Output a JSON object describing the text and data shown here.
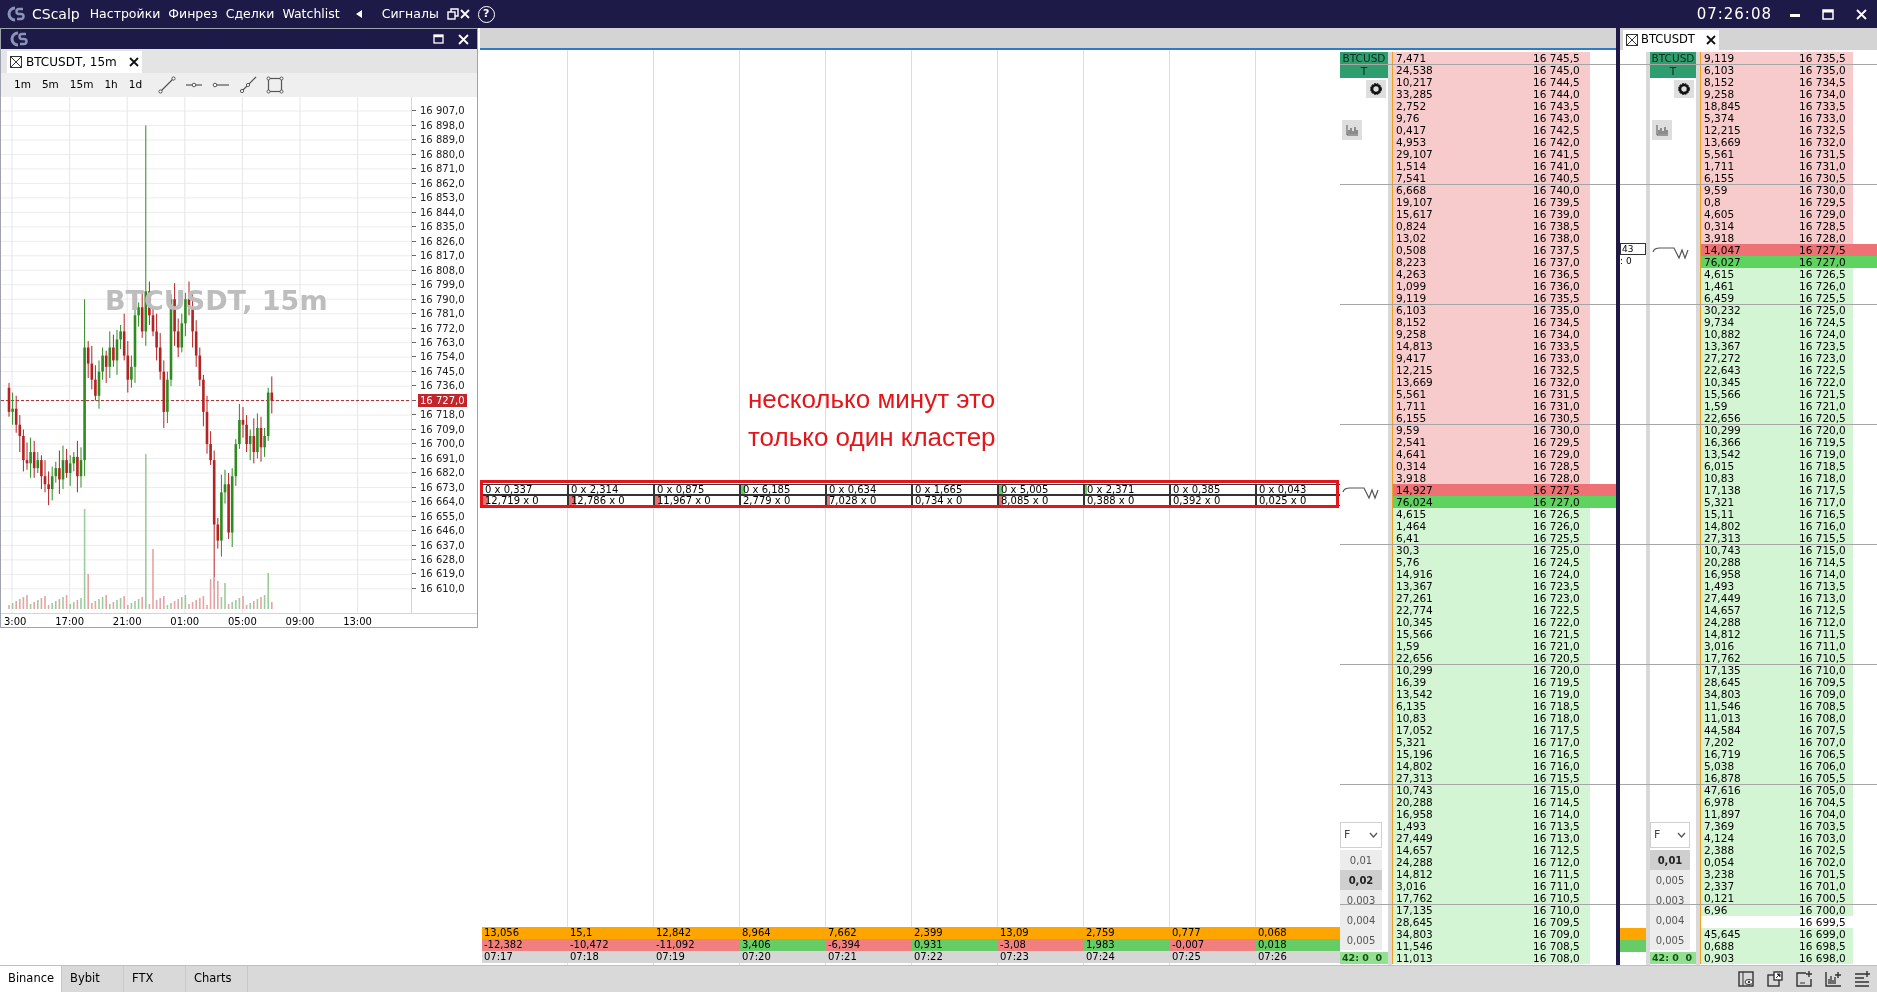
{
  "title_bar": {
    "app_name": "CScalp",
    "menu": [
      "Настройки",
      "Финрез",
      "Сделки",
      "Watchlist"
    ],
    "signals": "Сигналы",
    "help": "?",
    "clock": "07:26:08"
  },
  "chart_window": {
    "tab": "BTCUSDT, 15m",
    "timeframes": [
      "1m",
      "5m",
      "15m",
      "1h",
      "1d"
    ],
    "watermark": "BTCUSDT, 15m",
    "y_axis": [
      {
        "label": "16 907,0",
        "current": false
      },
      {
        "label": "16 898,0",
        "current": false
      },
      {
        "label": "16 889,0",
        "current": false
      },
      {
        "label": "16 880,0",
        "current": false
      },
      {
        "label": "16 871,0",
        "current": false
      },
      {
        "label": "16 862,0",
        "current": false
      },
      {
        "label": "16 853,0",
        "current": false
      },
      {
        "label": "16 844,0",
        "current": false
      },
      {
        "label": "16 835,0",
        "current": false
      },
      {
        "label": "16 826,0",
        "current": false
      },
      {
        "label": "16 817,0",
        "current": false
      },
      {
        "label": "16 808,0",
        "current": false
      },
      {
        "label": "16 799,0",
        "current": false
      },
      {
        "label": "16 790,0",
        "current": false
      },
      {
        "label": "16 781,0",
        "current": false
      },
      {
        "label": "16 772,0",
        "current": false
      },
      {
        "label": "16 763,0",
        "current": false
      },
      {
        "label": "16 754,0",
        "current": false
      },
      {
        "label": "16 745,0",
        "current": false
      },
      {
        "label": "16 736,0",
        "current": false
      },
      {
        "label": "16 727,0",
        "current": true
      },
      {
        "label": "16 718,0",
        "current": false
      },
      {
        "label": "16 709,0",
        "current": false
      },
      {
        "label": "16 700,0",
        "current": false
      },
      {
        "label": "16 691,0",
        "current": false
      },
      {
        "label": "16 682,0",
        "current": false
      },
      {
        "label": "16 673,0",
        "current": false
      },
      {
        "label": "16 664,0",
        "current": false
      },
      {
        "label": "16 655,0",
        "current": false
      },
      {
        "label": "16 646,0",
        "current": false
      },
      {
        "label": "16 637,0",
        "current": false
      },
      {
        "label": "16 628,0",
        "current": false
      },
      {
        "label": "16 619,0",
        "current": false
      },
      {
        "label": "16 610,0",
        "current": false
      }
    ],
    "x_axis": [
      "3:00",
      "17:00",
      "21:00",
      "01:00",
      "05:00",
      "09:00",
      "13:00"
    ]
  },
  "clusters": [
    {
      "buy": {
        "text": "0 x 0,337",
        "level": 0
      },
      "sell": {
        "text": "12,719 x 0",
        "level": 0.06
      },
      "volume": "13,056",
      "delta": {
        "text": "-12,382",
        "color": "#f08080"
      },
      "time": "07:17"
    },
    {
      "buy": {
        "text": "0 x 2,314",
        "level": 0
      },
      "sell": {
        "text": "12,786 x 0",
        "level": 0.08
      },
      "volume": "15,1",
      "delta": {
        "text": "-10,472",
        "color": "#f08080"
      },
      "time": "07:18"
    },
    {
      "buy": {
        "text": "0 x 0,875",
        "level": 0
      },
      "sell": {
        "text": "11,967 x 0",
        "level": 0.06
      },
      "volume": "12,842",
      "delta": {
        "text": "-11,092",
        "color": "#f08080"
      },
      "time": "07:19"
    },
    {
      "buy": {
        "text": "0 x 6,185",
        "level": 0.05
      },
      "sell": {
        "text": "2,779 x 0",
        "level": 0
      },
      "volume": "8,964",
      "delta": {
        "text": "3,406",
        "color": "#66cc66"
      },
      "time": "07:20"
    },
    {
      "buy": {
        "text": "0 x 0,634",
        "level": 0
      },
      "sell": {
        "text": "7,028 x 0",
        "level": 0.04
      },
      "volume": "7,662",
      "delta": {
        "text": "-6,394",
        "color": "#f08080"
      },
      "time": "07:21"
    },
    {
      "buy": {
        "text": "0 x 1,665",
        "level": 0
      },
      "sell": {
        "text": "0,734 x 0",
        "level": 0
      },
      "volume": "2,399",
      "delta": {
        "text": "0,931",
        "color": "#66cc66"
      },
      "time": "07:22"
    },
    {
      "buy": {
        "text": "0 x 5,005",
        "level": 0.05
      },
      "sell": {
        "text": "8,085 x 0",
        "level": 0.05
      },
      "volume": "13,09",
      "delta": {
        "text": "-3,08",
        "color": "#f08080"
      },
      "time": "07:23"
    },
    {
      "buy": {
        "text": "0 x 2,371",
        "level": 0.02
      },
      "sell": {
        "text": "0,388 x 0",
        "level": 0
      },
      "volume": "2,759",
      "delta": {
        "text": "1,983",
        "color": "#66cc66"
      },
      "time": "07:24"
    },
    {
      "buy": {
        "text": "0 x 0,385",
        "level": 0
      },
      "sell": {
        "text": "0,392 x 0",
        "level": 0
      },
      "volume": "0,777",
      "delta": {
        "text": "-0,007",
        "color": "#f08080"
      },
      "time": "07:25"
    },
    {
      "buy": {
        "text": "0 x 0,043",
        "level": 0
      },
      "sell": {
        "text": "0,025 x 0",
        "level": 0
      },
      "volume": "0,068",
      "delta": {
        "text": "0,018",
        "color": "#66cc66"
      },
      "time": "07:26"
    }
  ],
  "annotation": [
    "несколько минут это",
    "только один кластер"
  ],
  "order_books": [
    {
      "symbol": "BTCUSDT",
      "filter": "F",
      "steps": [
        {
          "label": "0,01",
          "selected": false
        },
        {
          "label": "0,02",
          "selected": true
        },
        {
          "label": "0,003",
          "selected": false
        },
        {
          "label": "0,004",
          "selected": false
        },
        {
          "label": "0,005",
          "selected": false
        }
      ],
      "status": "42: 0  0",
      "rows": [
        {
          "kind": "ask",
          "volume": "7,471",
          "price": "16 745,5"
        },
        {
          "kind": "ask",
          "volume": "24,538",
          "price": "16 745,0"
        },
        {
          "kind": "ask",
          "volume": "10,217",
          "price": "16 744,5"
        },
        {
          "kind": "ask",
          "volume": "33,285",
          "price": "16 744,0"
        },
        {
          "kind": "ask",
          "volume": "2,752",
          "price": "16 743,5"
        },
        {
          "kind": "ask",
          "volume": "9,76",
          "price": "16 743,0"
        },
        {
          "kind": "ask",
          "volume": "0,417",
          "price": "16 742,5"
        },
        {
          "kind": "ask",
          "volume": "4,953",
          "price": "16 742,0"
        },
        {
          "kind": "ask",
          "volume": "29,107",
          "price": "16 741,5"
        },
        {
          "kind": "ask",
          "volume": "1,514",
          "price": "16 741,0"
        },
        {
          "kind": "ask",
          "volume": "7,541",
          "price": "16 740,5"
        },
        {
          "kind": "ask",
          "volume": "6,668",
          "price": "16 740,0"
        },
        {
          "kind": "ask",
          "volume": "19,107",
          "price": "16 739,5"
        },
        {
          "kind": "ask",
          "volume": "15,617",
          "price": "16 739,0"
        },
        {
          "kind": "ask",
          "volume": "0,824",
          "price": "16 738,5"
        },
        {
          "kind": "ask",
          "volume": "13,02",
          "price": "16 738,0"
        },
        {
          "kind": "ask",
          "volume": "0,508",
          "price": "16 737,5"
        },
        {
          "kind": "ask",
          "volume": "8,223",
          "price": "16 737,0"
        },
        {
          "kind": "ask",
          "volume": "4,263",
          "price": "16 736,5"
        },
        {
          "kind": "ask",
          "volume": "1,099",
          "price": "16 736,0"
        },
        {
          "kind": "ask",
          "volume": "9,119",
          "price": "16 735,5"
        },
        {
          "kind": "ask",
          "volume": "6,103",
          "price": "16 735,0"
        },
        {
          "kind": "ask",
          "volume": "8,152",
          "price": "16 734,5"
        },
        {
          "kind": "ask",
          "volume": "9,258",
          "price": "16 734,0"
        },
        {
          "kind": "ask",
          "volume": "14,813",
          "price": "16 733,5"
        },
        {
          "kind": "ask",
          "volume": "9,417",
          "price": "16 733,0"
        },
        {
          "kind": "ask",
          "volume": "12,215",
          "price": "16 732,5"
        },
        {
          "kind": "ask",
          "volume": "13,669",
          "price": "16 732,0"
        },
        {
          "kind": "ask",
          "volume": "5,561",
          "price": "16 731,5"
        },
        {
          "kind": "ask",
          "volume": "1,711",
          "price": "16 731,0"
        },
        {
          "kind": "ask",
          "volume": "6,155",
          "price": "16 730,5"
        },
        {
          "kind": "ask",
          "volume": "9,59",
          "price": "16 730,0"
        },
        {
          "kind": "ask",
          "volume": "2,541",
          "price": "16 729,5"
        },
        {
          "kind": "ask",
          "volume": "4,641",
          "price": "16 729,0"
        },
        {
          "kind": "ask",
          "volume": "0,314",
          "price": "16 728,5"
        },
        {
          "kind": "ask",
          "volume": "3,918",
          "price": "16 728,0"
        },
        {
          "kind": "best_ask",
          "volume": "14,927",
          "price": "16 727,5"
        },
        {
          "kind": "best_bid",
          "volume": "76,024",
          "price": "16 727,0"
        },
        {
          "kind": "bid",
          "volume": "4,615",
          "price": "16 726,5"
        },
        {
          "kind": "bid",
          "volume": "1,464",
          "price": "16 726,0"
        },
        {
          "kind": "bid",
          "volume": "6,41",
          "price": "16 725,5"
        },
        {
          "kind": "bid",
          "volume": "30,3",
          "price": "16 725,0"
        },
        {
          "kind": "bid",
          "volume": "5,76",
          "price": "16 724,5"
        },
        {
          "kind": "bid",
          "volume": "14,916",
          "price": "16 724,0"
        },
        {
          "kind": "bid",
          "volume": "13,367",
          "price": "16 723,5"
        },
        {
          "kind": "bid",
          "volume": "27,261",
          "price": "16 723,0"
        },
        {
          "kind": "bid",
          "volume": "22,774",
          "price": "16 722,5"
        },
        {
          "kind": "bid",
          "volume": "10,345",
          "price": "16 722,0"
        },
        {
          "kind": "bid",
          "volume": "15,566",
          "price": "16 721,5"
        },
        {
          "kind": "bid",
          "volume": "1,59",
          "price": "16 721,0"
        },
        {
          "kind": "bid",
          "volume": "22,656",
          "price": "16 720,5"
        },
        {
          "kind": "bid",
          "volume": "10,299",
          "price": "16 720,0"
        },
        {
          "kind": "bid",
          "volume": "16,39",
          "price": "16 719,5"
        },
        {
          "kind": "bid",
          "volume": "13,542",
          "price": "16 719,0"
        },
        {
          "kind": "bid",
          "volume": "6,135",
          "price": "16 718,5"
        },
        {
          "kind": "bid",
          "volume": "10,83",
          "price": "16 718,0"
        },
        {
          "kind": "bid",
          "volume": "17,052",
          "price": "16 717,5"
        },
        {
          "kind": "bid",
          "volume": "5,321",
          "price": "16 717,0"
        },
        {
          "kind": "bid",
          "volume": "15,196",
          "price": "16 716,5"
        },
        {
          "kind": "bid",
          "volume": "14,802",
          "price": "16 716,0"
        },
        {
          "kind": "bid",
          "volume": "27,313",
          "price": "16 715,5"
        },
        {
          "kind": "bid",
          "volume": "10,743",
          "price": "16 715,0"
        },
        {
          "kind": "bid",
          "volume": "20,288",
          "price": "16 714,5"
        },
        {
          "kind": "bid",
          "volume": "16,958",
          "price": "16 714,0"
        },
        {
          "kind": "bid",
          "volume": "1,493",
          "price": "16 713,5"
        },
        {
          "kind": "bid",
          "volume": "27,449",
          "price": "16 713,0"
        },
        {
          "kind": "bid",
          "volume": "14,657",
          "price": "16 712,5"
        },
        {
          "kind": "bid",
          "volume": "24,288",
          "price": "16 712,0"
        },
        {
          "kind": "bid",
          "volume": "14,812",
          "price": "16 711,5"
        },
        {
          "kind": "bid",
          "volume": "3,016",
          "price": "16 711,0"
        },
        {
          "kind": "bid",
          "volume": "17,762",
          "price": "16 710,5"
        },
        {
          "kind": "bid",
          "volume": "17,135",
          "price": "16 710,0"
        },
        {
          "kind": "bid",
          "volume": "28,645",
          "price": "16 709,5"
        },
        {
          "kind": "bid",
          "volume": "34,803",
          "price": "16 709,0"
        },
        {
          "kind": "bid",
          "volume": "11,546",
          "price": "16 708,5"
        },
        {
          "kind": "bid",
          "volume": "11,013",
          "price": "16 708,0"
        }
      ]
    },
    {
      "tab": "BTCUSDT",
      "side_fragment": [
        "43",
        ": 0"
      ],
      "symbol": "BTCUSDT",
      "filter": "F",
      "steps": [
        {
          "label": "0,01",
          "selected": true
        },
        {
          "label": "0,005",
          "selected": false
        },
        {
          "label": "0,003",
          "selected": false
        },
        {
          "label": "0,004",
          "selected": false
        },
        {
          "label": "0,005",
          "selected": false
        }
      ],
      "status": "42: 0  0",
      "rows": [
        {
          "kind": "ask",
          "volume": "9,119",
          "price": "16 735,5"
        },
        {
          "kind": "ask",
          "volume": "6,103",
          "price": "16 735,0"
        },
        {
          "kind": "ask",
          "volume": "8,152",
          "price": "16 734,5"
        },
        {
          "kind": "ask",
          "volume": "9,258",
          "price": "16 734,0"
        },
        {
          "kind": "ask",
          "volume": "18,845",
          "price": "16 733,5"
        },
        {
          "kind": "ask",
          "volume": "5,374",
          "price": "16 733,0"
        },
        {
          "kind": "ask",
          "volume": "12,215",
          "price": "16 732,5"
        },
        {
          "kind": "ask",
          "volume": "13,669",
          "price": "16 732,0"
        },
        {
          "kind": "ask",
          "volume": "5,561",
          "price": "16 731,5"
        },
        {
          "kind": "ask",
          "volume": "1,711",
          "price": "16 731,0"
        },
        {
          "kind": "ask",
          "volume": "6,155",
          "price": "16 730,5"
        },
        {
          "kind": "ask",
          "volume": "9,59",
          "price": "16 730,0"
        },
        {
          "kind": "ask",
          "volume": "0,8",
          "price": "16 729,5"
        },
        {
          "kind": "ask",
          "volume": "4,605",
          "price": "16 729,0"
        },
        {
          "kind": "ask",
          "volume": "0,314",
          "price": "16 728,5"
        },
        {
          "kind": "ask",
          "volume": "3,918",
          "price": "16 728,0"
        },
        {
          "kind": "best_ask",
          "volume": "14,047",
          "price": "16 727,5"
        },
        {
          "kind": "best_bid",
          "volume": "76,027",
          "price": "16 727,0"
        },
        {
          "kind": "bid",
          "volume": "4,615",
          "price": "16 726,5"
        },
        {
          "kind": "bid",
          "volume": "1,461",
          "price": "16 726,0"
        },
        {
          "kind": "bid",
          "volume": "6,459",
          "price": "16 725,5"
        },
        {
          "kind": "bid",
          "volume": "30,232",
          "price": "16 725,0"
        },
        {
          "kind": "bid",
          "volume": "9,734",
          "price": "16 724,5"
        },
        {
          "kind": "bid",
          "volume": "10,882",
          "price": "16 724,0"
        },
        {
          "kind": "bid",
          "volume": "13,367",
          "price": "16 723,5"
        },
        {
          "kind": "bid",
          "volume": "27,272",
          "price": "16 723,0"
        },
        {
          "kind": "bid",
          "volume": "22,643",
          "price": "16 722,5"
        },
        {
          "kind": "bid",
          "volume": "10,345",
          "price": "16 722,0"
        },
        {
          "kind": "bid",
          "volume": "15,566",
          "price": "16 721,5"
        },
        {
          "kind": "bid",
          "volume": "1,59",
          "price": "16 721,0"
        },
        {
          "kind": "bid",
          "volume": "22,656",
          "price": "16 720,5"
        },
        {
          "kind": "bid",
          "volume": "10,299",
          "price": "16 720,0"
        },
        {
          "kind": "bid",
          "volume": "16,366",
          "price": "16 719,5"
        },
        {
          "kind": "bid",
          "volume": "13,542",
          "price": "16 719,0"
        },
        {
          "kind": "bid",
          "volume": "6,015",
          "price": "16 718,5"
        },
        {
          "kind": "bid",
          "volume": "10,83",
          "price": "16 718,0"
        },
        {
          "kind": "bid",
          "volume": "17,138",
          "price": "16 717,5"
        },
        {
          "kind": "bid",
          "volume": "5,321",
          "price": "16 717,0"
        },
        {
          "kind": "bid",
          "volume": "15,11",
          "price": "16 716,5"
        },
        {
          "kind": "bid",
          "volume": "14,802",
          "price": "16 716,0"
        },
        {
          "kind": "bid",
          "volume": "27,313",
          "price": "16 715,5"
        },
        {
          "kind": "bid",
          "volume": "10,743",
          "price": "16 715,0"
        },
        {
          "kind": "bid",
          "volume": "20,288",
          "price": "16 714,5"
        },
        {
          "kind": "bid",
          "volume": "16,958",
          "price": "16 714,0"
        },
        {
          "kind": "bid",
          "volume": "1,493",
          "price": "16 713,5"
        },
        {
          "kind": "bid",
          "volume": "27,449",
          "price": "16 713,0"
        },
        {
          "kind": "bid",
          "volume": "14,657",
          "price": "16 712,5"
        },
        {
          "kind": "bid",
          "volume": "24,288",
          "price": "16 712,0"
        },
        {
          "kind": "bid",
          "volume": "14,812",
          "price": "16 711,5"
        },
        {
          "kind": "bid",
          "volume": "3,016",
          "price": "16 711,0"
        },
        {
          "kind": "bid",
          "volume": "17,762",
          "price": "16 710,5"
        },
        {
          "kind": "bid",
          "volume": "17,135",
          "price": "16 710,0"
        },
        {
          "kind": "bid",
          "volume": "28,645",
          "price": "16 709,5"
        },
        {
          "kind": "bid",
          "volume": "34,803",
          "price": "16 709,0"
        },
        {
          "kind": "bid",
          "volume": "11,546",
          "price": "16 708,5"
        },
        {
          "kind": "bid",
          "volume": "11,013",
          "price": "16 708,0"
        },
        {
          "kind": "bid",
          "volume": "44,584",
          "price": "16 707,5"
        },
        {
          "kind": "bid",
          "volume": "7,202",
          "price": "16 707,0"
        },
        {
          "kind": "bid",
          "volume": "16,719",
          "price": "16 706,5"
        },
        {
          "kind": "bid",
          "volume": "5,038",
          "price": "16 706,0"
        },
        {
          "kind": "bid",
          "volume": "16,878",
          "price": "16 705,5"
        },
        {
          "kind": "bid",
          "volume": "47,616",
          "price": "16 705,0"
        },
        {
          "kind": "bid",
          "volume": "6,978",
          "price": "16 704,5"
        },
        {
          "kind": "bid",
          "volume": "11,897",
          "price": "16 704,0"
        },
        {
          "kind": "bid",
          "volume": "7,369",
          "price": "16 703,5"
        },
        {
          "kind": "bid",
          "volume": "4,124",
          "price": "16 703,0"
        },
        {
          "kind": "bid",
          "volume": "2,388",
          "price": "16 702,5"
        },
        {
          "kind": "bid",
          "volume": "0,054",
          "price": "16 702,0"
        },
        {
          "kind": "bid",
          "volume": "3,238",
          "price": "16 701,5"
        },
        {
          "kind": "bid",
          "volume": "2,337",
          "price": "16 701,0"
        },
        {
          "kind": "bid",
          "volume": "0,121",
          "price": "16 700,5"
        },
        {
          "kind": "bid",
          "volume": "6,96",
          "price": "16 700,0"
        },
        {
          "kind": "empty",
          "price": "16 699,5"
        },
        {
          "kind": "bid",
          "volume": "45,645",
          "price": "16 699,0"
        },
        {
          "kind": "bid",
          "volume": "0,688",
          "price": "16 698,5"
        },
        {
          "kind": "bid",
          "volume": "0,903",
          "price": "16 698,0"
        }
      ]
    }
  ],
  "exchange_tabs": [
    {
      "label": "Binance",
      "selected": true
    },
    {
      "label": "Bybit",
      "selected": false
    },
    {
      "label": "FTX",
      "selected": false
    },
    {
      "label": "Charts",
      "selected": false
    }
  ]
}
